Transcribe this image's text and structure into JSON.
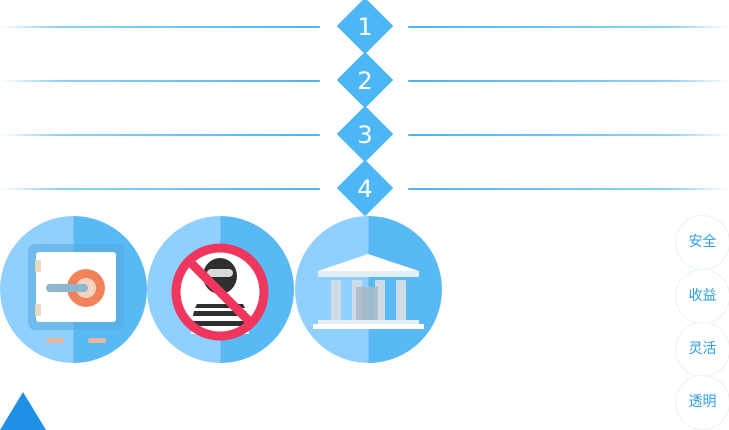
{
  "steps": [
    {
      "number": "1"
    },
    {
      "number": "2"
    },
    {
      "number": "3"
    },
    {
      "number": "4"
    }
  ],
  "features": [
    {
      "icon": "safe-icon"
    },
    {
      "icon": "no-thief-icon"
    },
    {
      "icon": "bank-icon"
    }
  ],
  "tags": [
    {
      "label": "安全"
    },
    {
      "label": "收益"
    },
    {
      "label": "灵活"
    },
    {
      "label": "透明"
    }
  ],
  "colors": {
    "accent": "#4db7f6",
    "circle_light": "#8fd0ff",
    "circle_dark": "#58b9f5",
    "tag_text": "#2f9de8",
    "arrow": "#1f90e6"
  }
}
